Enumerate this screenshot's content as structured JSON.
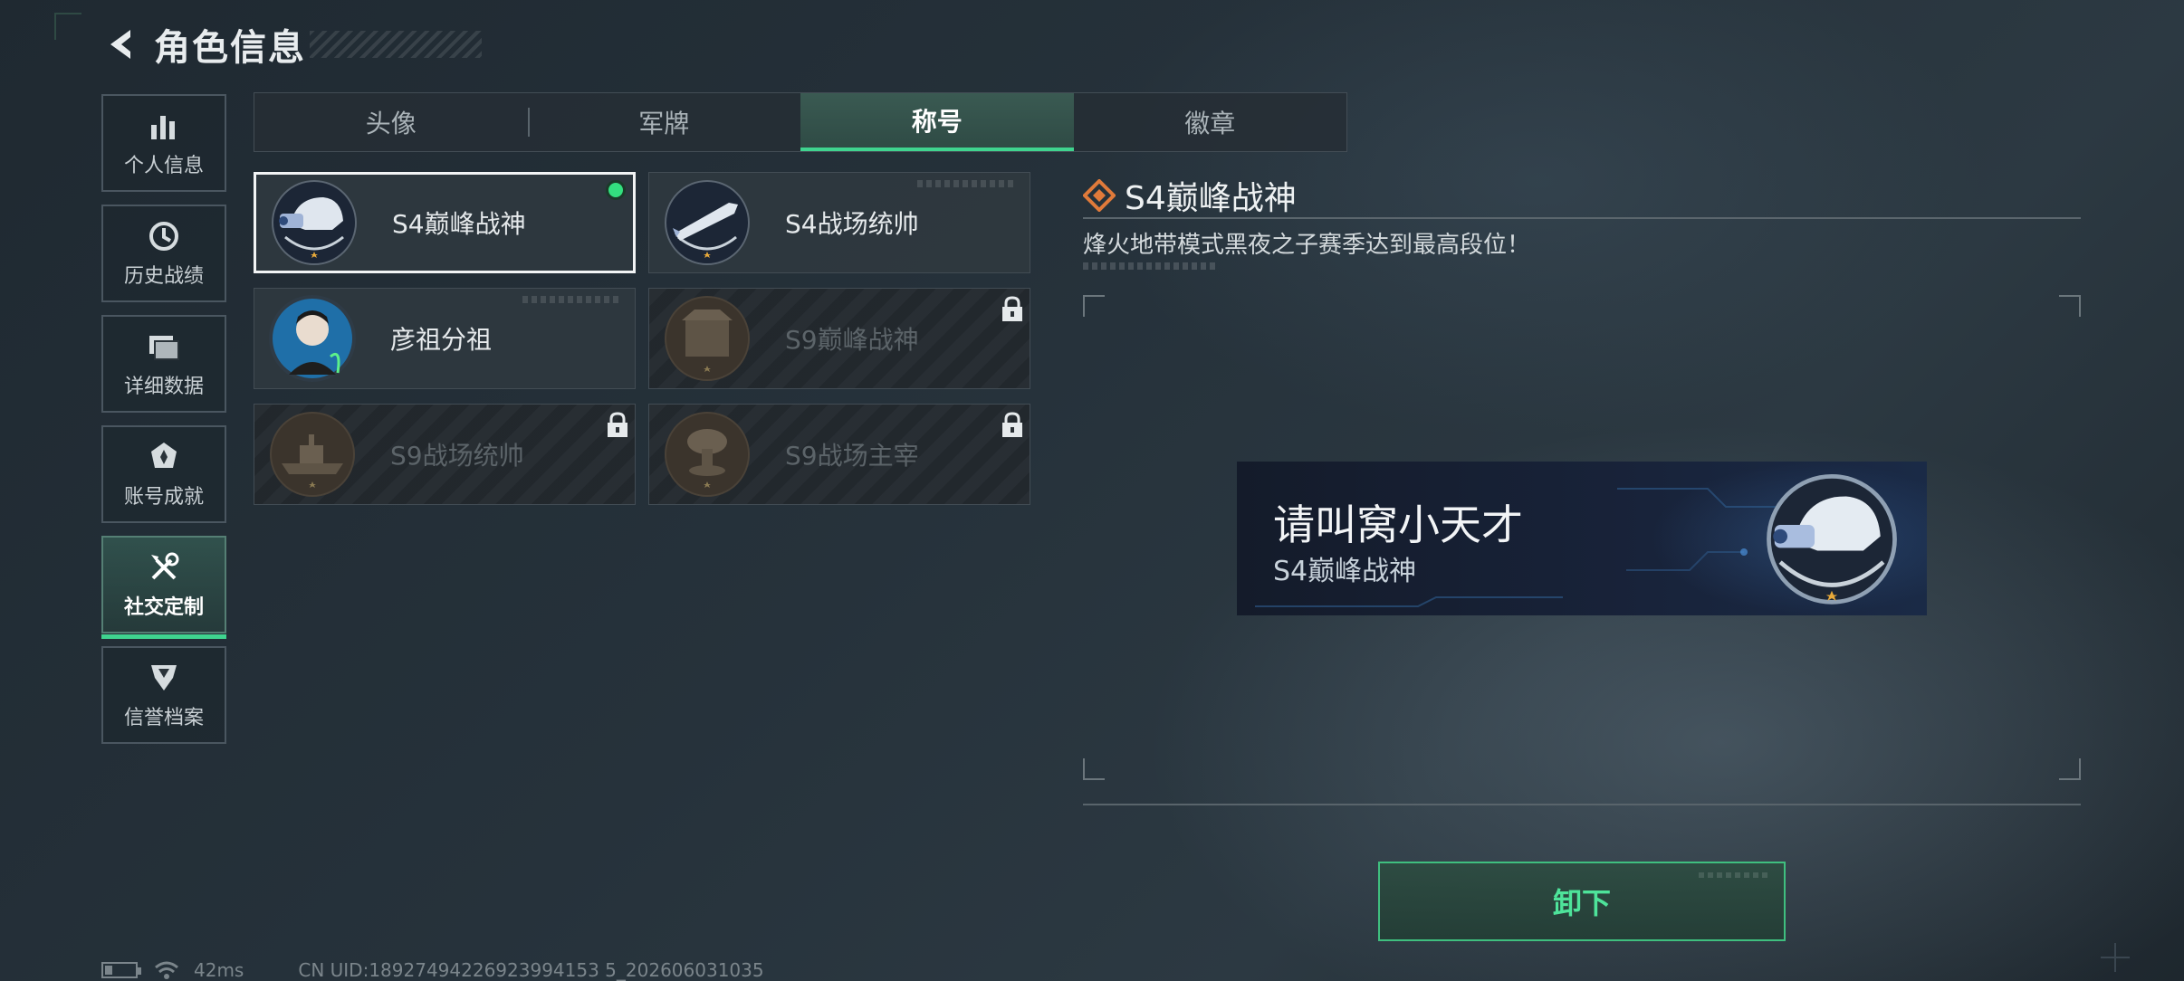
{
  "header": {
    "title": "角色信息"
  },
  "sidenav": {
    "items": [
      {
        "label": "个人信息",
        "icon": "bar-chart-icon"
      },
      {
        "label": "历史战绩",
        "icon": "history-clock-icon"
      },
      {
        "label": "详细数据",
        "icon": "folder-icon"
      },
      {
        "label": "账号成就",
        "icon": "achievement-icon"
      },
      {
        "label": "社交定制",
        "icon": "tools-icon",
        "active": true
      },
      {
        "label": "信誉档案",
        "icon": "shield-emblem-icon"
      }
    ]
  },
  "tabs": [
    {
      "label": "头像"
    },
    {
      "label": "军牌"
    },
    {
      "label": "称号",
      "active": true
    },
    {
      "label": "徽章"
    }
  ],
  "titles": [
    {
      "name": "S4巅峰战神",
      "emblem": "helmet-emblem-icon",
      "status": "equipped"
    },
    {
      "name": "S4战场统帅",
      "emblem": "missile-emblem-icon",
      "status": "owned"
    },
    {
      "name": "彦祖分祖",
      "emblem": "portrait-emblem-icon",
      "status": "owned"
    },
    {
      "name": "S9巅峰战神",
      "emblem": "fortress-emblem-icon",
      "status": "locked"
    },
    {
      "name": "S9战场统帅",
      "emblem": "warship-emblem-icon",
      "status": "locked"
    },
    {
      "name": "S9战场主宰",
      "emblem": "mushroom-cloud-emblem-icon",
      "status": "locked"
    }
  ],
  "detail": {
    "title": "S4巅峰战神",
    "description": "烽火地带模式黑夜之子赛季达到最高段位！",
    "preview": {
      "player_name": "请叫窝小天才",
      "title": "S4巅峰战神"
    },
    "action_label": "卸下"
  },
  "status_bar": {
    "ping": "42ms",
    "uid": "CN UID:18927494226923994153 5_202606031035"
  },
  "colors": {
    "accent_green": "#3fd48f",
    "equipped_dot": "#33e07f",
    "title_icon_orange": "#e07a3a"
  }
}
